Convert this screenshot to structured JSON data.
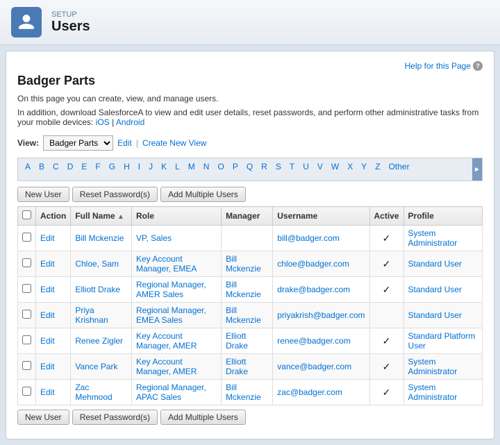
{
  "header": {
    "setup_label": "SETUP",
    "page_title": "Users"
  },
  "page": {
    "heading": "Badger Parts",
    "description": "On this page you can create, view, and manage users.",
    "description_extra": "In addition, download SalesforceA to view and edit user details, reset passwords, and perform other administrative tasks from your mobile devices:",
    "ios_link": "iOS",
    "android_link": "Android",
    "help_link": "Help for this Page"
  },
  "view_bar": {
    "label": "View:",
    "selected": "Badger Parts",
    "edit_link": "Edit",
    "create_link": "Create New View"
  },
  "alphabet": [
    "A",
    "B",
    "C",
    "D",
    "E",
    "F",
    "G",
    "H",
    "I",
    "J",
    "K",
    "L",
    "M",
    "N",
    "O",
    "P",
    "Q",
    "R",
    "S",
    "T",
    "U",
    "V",
    "W",
    "X",
    "Y",
    "Z",
    "Other"
  ],
  "buttons": {
    "new_user": "New User",
    "reset_passwords": "Reset Password(s)",
    "add_multiple_users": "Add Multiple Users"
  },
  "table": {
    "columns": [
      "",
      "Action",
      "Full Name",
      "Role",
      "Manager",
      "Username",
      "Active",
      "Profile"
    ],
    "rows": [
      {
        "checkbox": "",
        "action": "Edit",
        "full_name": "Bill Mckenzie",
        "role": "VP, Sales",
        "manager": "",
        "username": "bill@badger.com",
        "active": true,
        "profile": "System Administrator"
      },
      {
        "checkbox": "",
        "action": "Edit",
        "full_name": "Chloe, Sam",
        "role": "Key Account Manager, EMEA",
        "manager": "Bill Mckenzie",
        "username": "chloe@badger.com",
        "active": true,
        "profile": "Standard User"
      },
      {
        "checkbox": "",
        "action": "Edit",
        "full_name": "Elliott Drake",
        "role": "Regional Manager, AMER Sales",
        "manager": "Bill Mckenzie",
        "username": "drake@badger.com",
        "active": true,
        "profile": "Standard User"
      },
      {
        "checkbox": "",
        "action": "Edit",
        "full_name": "Priya Krishnan",
        "role": "Regional Manager, EMEA Sales",
        "manager": "Bill Mckenzie",
        "username": "priyakrish@badger.com",
        "active": false,
        "profile": "Standard User"
      },
      {
        "checkbox": "",
        "action": "Edit",
        "full_name": "Renee Zigler",
        "role": "Key Account Manager, AMER",
        "manager": "Elliott Drake",
        "username": "renee@badger.com",
        "active": true,
        "profile": "Standard Platform User"
      },
      {
        "checkbox": "",
        "action": "Edit",
        "full_name": "Vance Park",
        "role": "Key Account Manager, AMER",
        "manager": "Elliott Drake",
        "username": "vance@badger.com",
        "active": true,
        "profile": "System Administrator"
      },
      {
        "checkbox": "",
        "action": "Edit",
        "full_name": "Zac Mehmood",
        "role": "Regional Manager, APAC Sales",
        "manager": "Bill Mckenzie",
        "username": "zac@badger.com",
        "active": true,
        "profile": "System Administrator"
      }
    ]
  }
}
